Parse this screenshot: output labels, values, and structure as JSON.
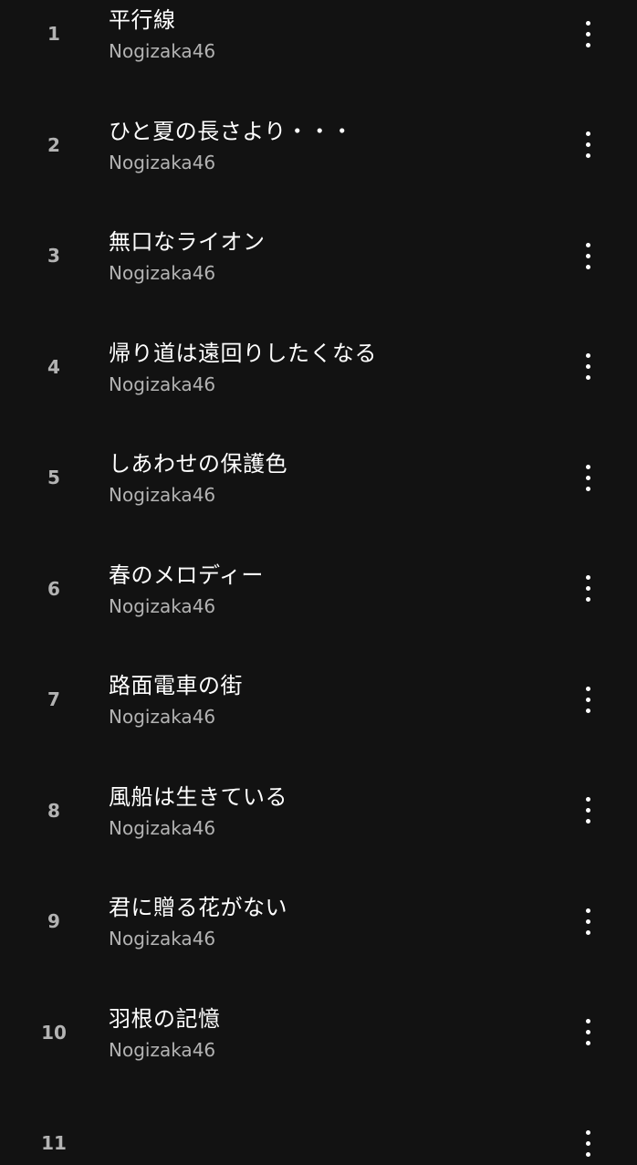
{
  "tracks": [
    {
      "number": "1",
      "title": "平行線",
      "artist": "Nogizaka46"
    },
    {
      "number": "2",
      "title": "ひと夏の長さより・・・",
      "artist": "Nogizaka46"
    },
    {
      "number": "3",
      "title": "無口なライオン",
      "artist": "Nogizaka46"
    },
    {
      "number": "4",
      "title": "帰り道は遠回りしたくなる",
      "artist": "Nogizaka46"
    },
    {
      "number": "5",
      "title": "しあわせの保護色",
      "artist": "Nogizaka46"
    },
    {
      "number": "6",
      "title": "春のメロディー",
      "artist": "Nogizaka46"
    },
    {
      "number": "7",
      "title": "路面電車の街",
      "artist": "Nogizaka46"
    },
    {
      "number": "8",
      "title": "風船は生きている",
      "artist": "Nogizaka46"
    },
    {
      "number": "9",
      "title": "君に贈る花がない",
      "artist": "Nogizaka46"
    },
    {
      "number": "10",
      "title": "羽根の記憶",
      "artist": "Nogizaka46"
    },
    {
      "number": "11",
      "title": "",
      "artist": ""
    }
  ],
  "icons": {
    "more": "more-vertical-icon"
  },
  "colors": {
    "background": "#121212",
    "title": "#ffffff",
    "secondary": "#b3b3b3"
  }
}
